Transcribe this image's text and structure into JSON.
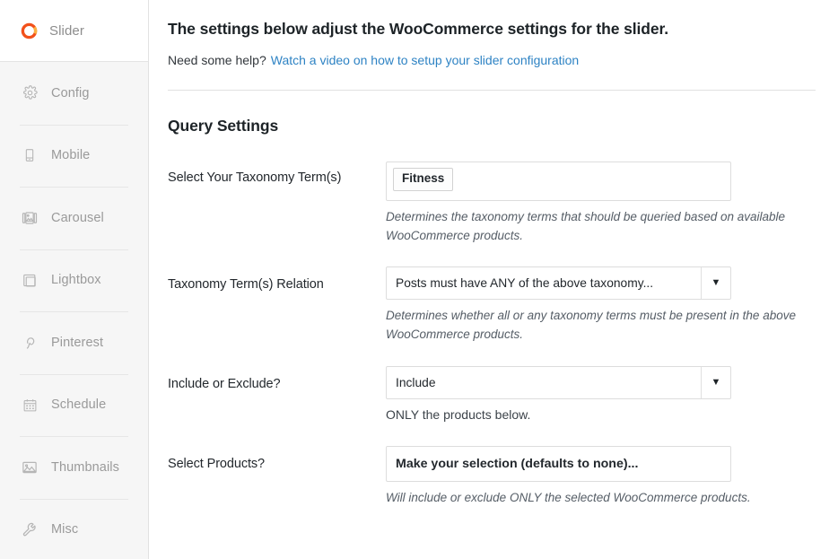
{
  "sidebar": {
    "brand": {
      "label": "Slider",
      "icon": "slider-ring-icon",
      "color": "#f2511b"
    },
    "items": [
      {
        "label": "Config",
        "icon": "gear-icon"
      },
      {
        "label": "Mobile",
        "icon": "mobile-phone-icon"
      },
      {
        "label": "Carousel",
        "icon": "carousel-image-icon"
      },
      {
        "label": "Lightbox",
        "icon": "lightbox-window-icon"
      },
      {
        "label": "Pinterest",
        "icon": "pinterest-icon"
      },
      {
        "label": "Schedule",
        "icon": "calendar-icon"
      },
      {
        "label": "Thumbnails",
        "icon": "thumbnails-image-icon"
      },
      {
        "label": "Misc",
        "icon": "wrench-icon"
      }
    ]
  },
  "main": {
    "heading": "The settings below adjust the WooCommerce settings for the slider.",
    "help_prefix": "Need some help?",
    "help_link": "Watch a video on how to setup your slider configuration",
    "link_color": "#2e83c4",
    "section_title": "Query Settings",
    "fields": [
      {
        "label": "Select Your Taxonomy Term(s)",
        "type": "token-multiselect",
        "tokens": [
          "Fitness"
        ],
        "description": "Determines the taxonomy terms that should be queried based on available WooCommerce products.",
        "description_style": "italic"
      },
      {
        "label": "Taxonomy Term(s) Relation",
        "type": "select",
        "value": "Posts must have ANY of the above taxonomy...",
        "description": "Determines whether all or any taxonomy terms must be present in the above WooCommerce products.",
        "description_style": "italic"
      },
      {
        "label": "Include or Exclude?",
        "type": "select",
        "value": "Include",
        "description": "ONLY the products below.",
        "description_style": "plain"
      },
      {
        "label": "Select Products?",
        "type": "select-placeholder",
        "value": "Make your selection (defaults to none)...",
        "description": "Will include or exclude ONLY the selected WooCommerce products.",
        "description_style": "italic"
      }
    ],
    "dropdown_arrow_glyph": "▼"
  }
}
